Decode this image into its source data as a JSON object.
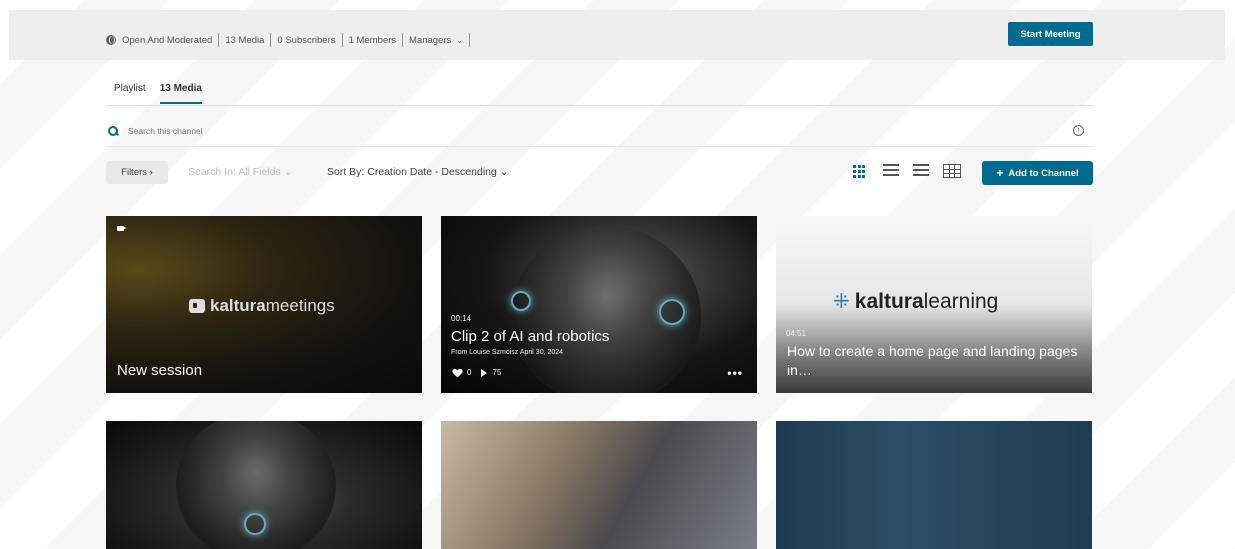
{
  "channel_meta": {
    "visibility": "Open And Moderated",
    "media_count": "13 Media",
    "subscribers": "0 Subscribers",
    "members": "1 Members",
    "managers": "Managers"
  },
  "start_meeting_label": "Start Meeting",
  "tabs": [
    {
      "label": "Playlist",
      "active": false
    },
    {
      "label": "13 Media",
      "active": true
    }
  ],
  "search": {
    "placeholder": "Search this channel"
  },
  "toolbar": {
    "filters_label": "Filters ›",
    "search_in_label": "Search In: All Fields ⌄",
    "sort_by_label": "Sort By: Creation Date - Descending ⌄",
    "add_to_channel_label": "Add to Channel"
  },
  "colors": {
    "accent": "#006b8f"
  },
  "cards": [
    {
      "logo_text_bold": "kaltura",
      "logo_text_light": "meetings",
      "title": "New session"
    },
    {
      "duration": "00:14",
      "title": "Clip 2 of AI and robotics",
      "byline": "From Louise Szmoisz April 30, 2024",
      "likes": "0",
      "plays": "75"
    },
    {
      "logo_text_bold": "kaltura",
      "logo_text_light": "learning",
      "duration": "04:51",
      "title": "How to create a home page and landing pages in…"
    },
    {},
    {},
    {}
  ]
}
